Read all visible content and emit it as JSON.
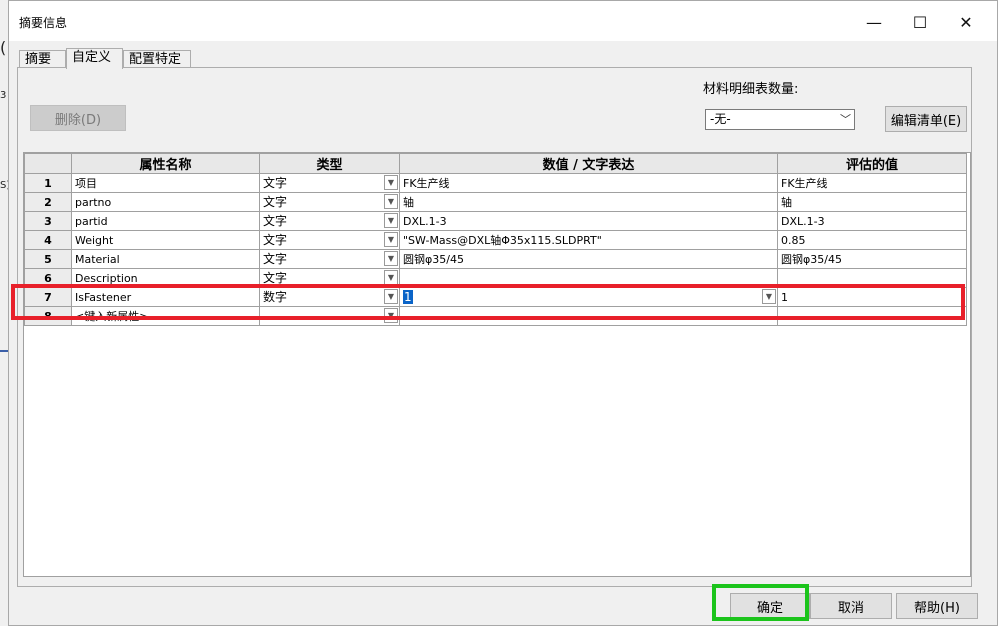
{
  "window": {
    "title": "摘要信息"
  },
  "titlebar": {
    "minimize_glyph": "—",
    "maximize_glyph": "☐",
    "close_glyph": "✕"
  },
  "tabs": [
    {
      "label": "摘要"
    },
    {
      "label": "自定义",
      "active": true
    },
    {
      "label": "配置特定"
    }
  ],
  "toolbar": {
    "delete_label": "删除(D)",
    "bom_qty_label": "材料明细表数量:",
    "bom_qty_value": "-无-",
    "edit_list_label": "编辑清单(E)"
  },
  "grid": {
    "headers": [
      "属性名称",
      "类型",
      "数值 / 文字表达",
      "评估的值"
    ],
    "rows": [
      {
        "num": "1",
        "name": "项目",
        "type": "文字",
        "value": "FK生产线",
        "eval": "FK生产线"
      },
      {
        "num": "2",
        "name": "partno",
        "type": "文字",
        "value": "轴",
        "eval": "轴"
      },
      {
        "num": "3",
        "name": "partid",
        "type": "文字",
        "value": "DXL.1-3",
        "eval": "DXL.1-3"
      },
      {
        "num": "4",
        "name": "Weight",
        "type": "文字",
        "value": "\"SW-Mass@DXL轴Φ35x115.SLDPRT\"",
        "eval": "0.85"
      },
      {
        "num": "5",
        "name": "Material",
        "type": "文字",
        "value": "圆钢φ35/45",
        "eval": "圆钢φ35/45"
      },
      {
        "num": "6",
        "name": "Description",
        "type": "文字",
        "value": "",
        "eval": ""
      },
      {
        "num": "7",
        "name": "IsFastener",
        "type": "数字",
        "value": "1",
        "eval": "1"
      },
      {
        "num": "8",
        "name": "<键入新属性>",
        "type": "",
        "value": "",
        "eval": ""
      }
    ]
  },
  "footer": {
    "ok_label": "确定",
    "cancel_label": "取消",
    "help_label": "帮助(H)"
  },
  "colors": {
    "highlight_red": "#e8202a",
    "highlight_green": "#1bc41b",
    "selection": "#0a64c8"
  },
  "background_fragments": [
    "(",
    "3",
    "S)"
  ]
}
